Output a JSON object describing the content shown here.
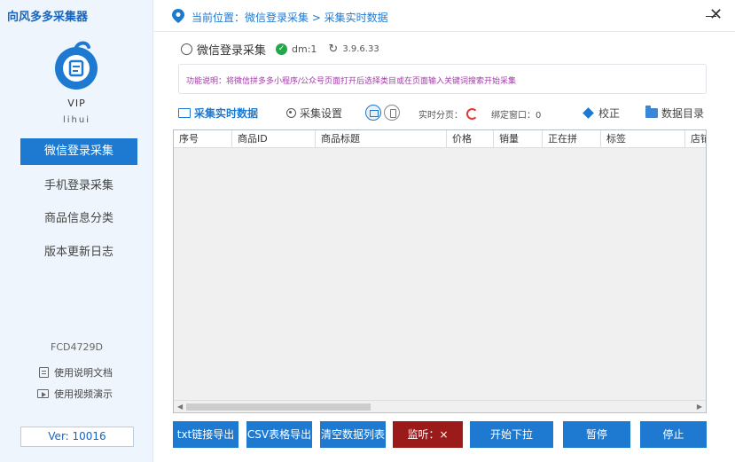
{
  "app": {
    "title": "向风多多采集器"
  },
  "sidebar": {
    "vip_label": "VIP",
    "username": "lihui",
    "nav": [
      {
        "label": "微信登录采集",
        "active": true
      },
      {
        "label": "手机登录采集",
        "active": false
      },
      {
        "label": "商品信息分类",
        "active": false
      },
      {
        "label": "版本更新日志",
        "active": false
      }
    ],
    "device_code": "FCD4729D",
    "links": [
      {
        "label": "使用说明文档",
        "icon": "document-icon"
      },
      {
        "label": "使用视频演示",
        "icon": "video-icon"
      }
    ],
    "version": "Ver:  10016"
  },
  "header": {
    "breadcrumb": "当前位置：微信登录采集 > 采集实时数据",
    "close_symbol": "✕"
  },
  "section": {
    "title": "微信登录采集",
    "dm_label": "dm:1",
    "app_version": "3.9.6.33"
  },
  "notice": {
    "text": "功能说明：将微信拼多多小程序/公众号页面打开后选择类目或在页面输入关键词搜索开始采集"
  },
  "toolbar": {
    "realtime_tab": "采集实时数据",
    "settings_tab": "采集设置",
    "realtime_split_label": "实时分页：",
    "bound_window_label": "绑定窗口：0",
    "calibrate_label": "校正",
    "data_dir_label": "数据目录"
  },
  "table": {
    "columns": [
      "序号",
      "商品ID",
      "商品标题",
      "价格",
      "销量",
      "正在拼",
      "标签",
      "店铺"
    ],
    "rows": []
  },
  "buttons": {
    "txt_export": "txt链接导出",
    "csv_export": "CSV表格导出",
    "clear_list": "清空数据列表",
    "listen": "监听：×",
    "start_pull": "开始下拉",
    "pause": "暂停",
    "stop": "停止"
  },
  "colors": {
    "primary": "#1e7ad1",
    "sidebar_bg": "#eef5fc",
    "listen_button": "#9b1b1b",
    "notice_text": "#a23aa8",
    "status_ok": "#22a84a"
  }
}
